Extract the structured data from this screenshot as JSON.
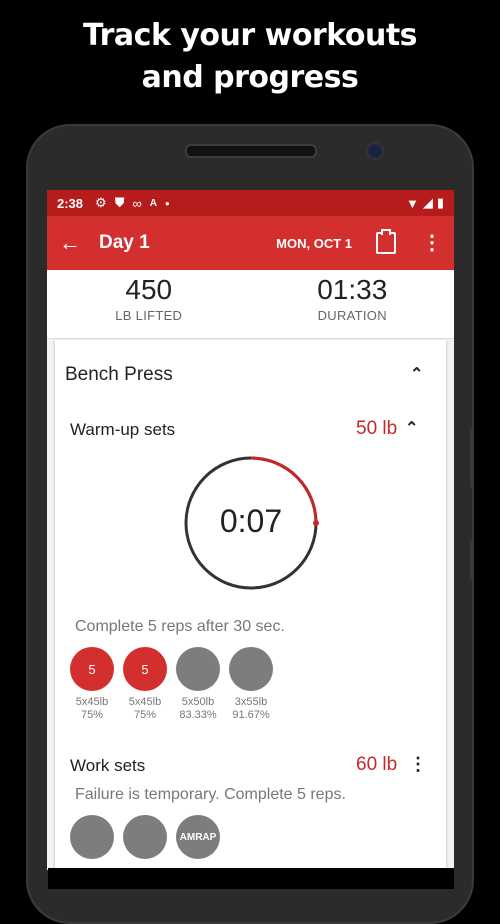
{
  "promo": {
    "line1": "Track your workouts",
    "line2": "and progress"
  },
  "status": {
    "time": "2:38"
  },
  "appbar": {
    "title": "Day 1",
    "date": "MON, OCT 1"
  },
  "summary": [
    {
      "value": "450",
      "label": "LB LIFTED"
    },
    {
      "value": "01:33",
      "label": "DURATION"
    }
  ],
  "exercise": {
    "name": "Bench Press"
  },
  "warmup": {
    "title": "Warm-up sets",
    "weight": "50 lb",
    "timer": "0:07",
    "timer_progress": 0.25,
    "hint": "Complete 5 reps after 30 sec.",
    "sets": [
      {
        "reps": "5",
        "line1": "5x45lb",
        "line2": "75%",
        "done": true
      },
      {
        "reps": "5",
        "line1": "5x45lb",
        "line2": "75%",
        "done": true
      },
      {
        "reps": "",
        "line1": "5x50lb",
        "line2": "83.33%",
        "done": false
      },
      {
        "reps": "",
        "line1": "3x55lb",
        "line2": "91.67%",
        "done": false
      }
    ]
  },
  "work": {
    "title": "Work sets",
    "weight": "60 lb",
    "hint": "Failure is temporary. Complete 5 reps.",
    "sets": [
      {
        "reps": ""
      },
      {
        "reps": ""
      },
      {
        "reps": "AMRAP"
      }
    ]
  }
}
